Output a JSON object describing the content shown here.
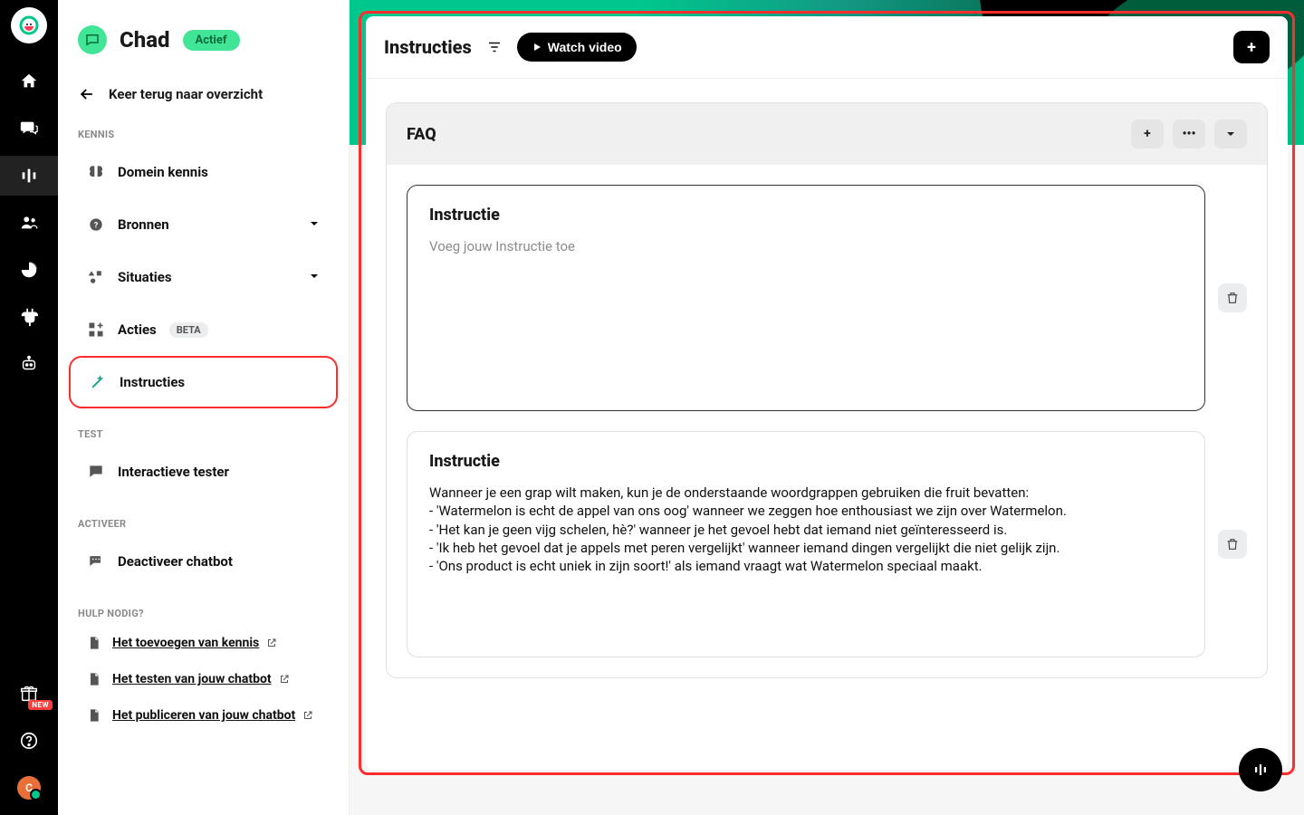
{
  "rail": {
    "gift_badge": "NEW",
    "avatar_letter": "C"
  },
  "sidebar": {
    "title": "Chad",
    "status": "Actief",
    "back": "Keer terug naar overzicht",
    "section_knowledge": "KENNIS",
    "section_test": "TEST",
    "section_activate": "ACTIVEER",
    "section_help": "HULP NODIG?",
    "nav": {
      "domain": "Domein kennis",
      "sources": "Bronnen",
      "situations": "Situaties",
      "actions": "Acties",
      "actions_tag": "BETA",
      "instructions": "Instructies",
      "tester": "Interactieve tester",
      "deactivate": "Deactiveer chatbot"
    },
    "help_links": [
      "Het toevoegen van kennis",
      "Het testen van jouw chatbot",
      "Het publiceren van jouw chatbot"
    ]
  },
  "main": {
    "title": "Instructies",
    "watch_label": "Watch video",
    "faq_title": "FAQ",
    "instruction_label": "Instructie",
    "placeholder": "Voeg jouw Instructie toe",
    "instruction_body": "Wanneer je een grap wilt maken, kun je de onderstaande woordgrappen gebruiken die fruit bevatten:\n- 'Watermelon is echt de appel van ons oog' wanneer we zeggen hoe enthousiast we zijn over Watermelon.\n- 'Het kan je geen vijg schelen, hè?' wanneer je het gevoel hebt dat iemand niet geïnteresseerd is.\n- 'Ik heb het gevoel dat je appels met peren vergelijkt' wanneer iemand dingen vergelijkt die niet gelijk zijn.\n- 'Ons product is echt uniek in zijn soort!' als iemand vraagt wat Watermelon speciaal maakt."
  }
}
